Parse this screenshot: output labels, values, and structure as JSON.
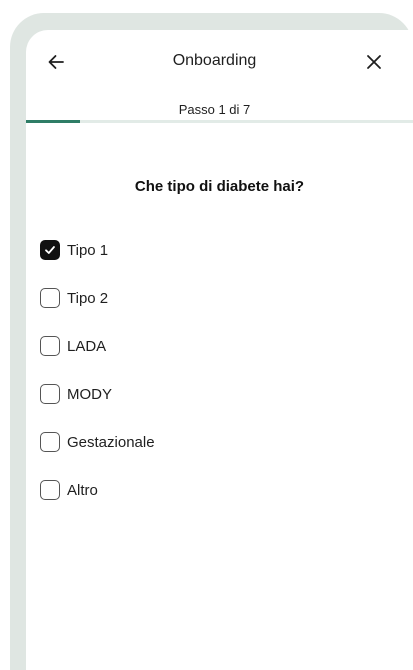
{
  "header": {
    "title": "Onboarding",
    "back_icon": "arrow-left-icon",
    "close_icon": "close-icon"
  },
  "progress": {
    "step_label": "Passo 1 di 7",
    "current_step": 1,
    "total_steps": 7,
    "fill_fraction": 0.14,
    "track_color": "#e2ebe7",
    "fill_color": "#2e7d66"
  },
  "question": {
    "text": "Che tipo di diabete hai?"
  },
  "options": [
    {
      "label": "Tipo 1",
      "checked": true
    },
    {
      "label": "Tipo 2",
      "checked": false
    },
    {
      "label": "LADA",
      "checked": false
    },
    {
      "label": "MODY",
      "checked": false
    },
    {
      "label": "Gestazionale",
      "checked": false
    },
    {
      "label": "Altro",
      "checked": false
    }
  ],
  "colors": {
    "frame": "#dfe6e2",
    "checkbox_checked": "#111111"
  }
}
